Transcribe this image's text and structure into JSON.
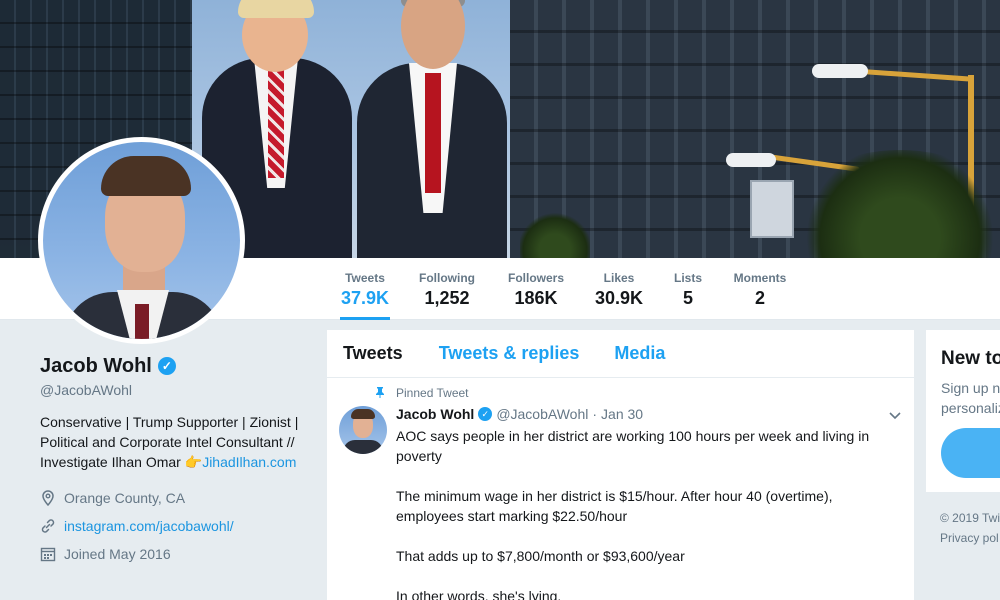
{
  "stats": [
    {
      "label": "Tweets",
      "value": "37.9K",
      "active": true
    },
    {
      "label": "Following",
      "value": "1,252"
    },
    {
      "label": "Followers",
      "value": "186K"
    },
    {
      "label": "Likes",
      "value": "30.9K"
    },
    {
      "label": "Lists",
      "value": "5"
    },
    {
      "label": "Moments",
      "value": "2"
    }
  ],
  "profile": {
    "name": "Jacob Wohl",
    "handle": "@JacobAWohl",
    "bio_line1": "Conservative | Trump Supporter | Zionist |",
    "bio_line2": "Political and Corporate Intel Consultant //",
    "bio_line3_prefix": "Investigate Ilhan Omar ",
    "bio_emoji": "👉",
    "bio_link": "JihadIlhan.com",
    "location": "Orange County, CA",
    "website": "instagram.com/jacobawohl/",
    "joined": "Joined May 2016"
  },
  "timeline": {
    "tabs": [
      "Tweets",
      "Tweets & replies",
      "Media"
    ],
    "pinned_label": "Pinned Tweet",
    "tweet": {
      "name": "Jacob Wohl",
      "handle": "@JacobAWohl",
      "dot": "·",
      "date": "Jan 30",
      "paragraphs": [
        "AOC says people in her district are working 100 hours per week and living in poverty",
        "The minimum wage in her district is $15/hour. After hour 40 (overtime), employees start marking $22.50/hour",
        "That adds up to $7,800/month or $93,600/year",
        "In other words, she's lying."
      ]
    }
  },
  "sidebar": {
    "title": "New to",
    "text_line1": "Sign up n",
    "text_line2": "personaliz"
  },
  "footer": {
    "line1": "© 2019 Twi",
    "line2": "Privacy pol"
  },
  "colors": {
    "accent": "#1da1f2",
    "link": "#1b95e0",
    "muted": "#657786"
  }
}
